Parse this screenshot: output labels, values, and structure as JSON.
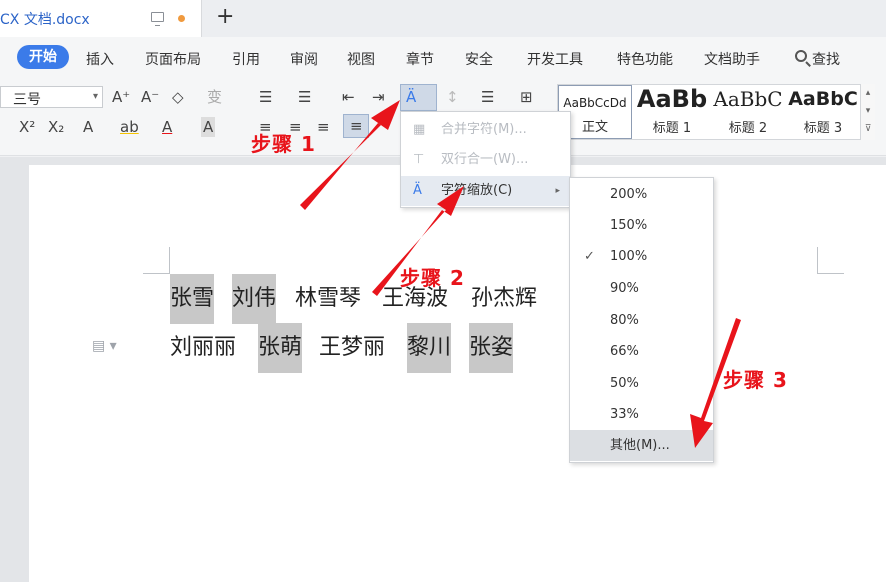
{
  "tab": {
    "title": "CX 文档.docx"
  },
  "menu": [
    "开始",
    "插入",
    "页面布局",
    "引用",
    "审阅",
    "视图",
    "章节",
    "安全",
    "开发工具",
    "特色功能",
    "文档助手"
  ],
  "search_label": "查找",
  "ribbon": {
    "font_size": "三号",
    "row1": [
      "A⁺",
      "A⁻",
      "◇",
      "变",
      "☰",
      "☰",
      "⇤",
      "⇥",
      "Ä",
      "↕"
    ],
    "row2": [
      "X²",
      "X₂",
      "A",
      "ab",
      "A",
      "A"
    ]
  },
  "styles": [
    {
      "sample": "AaBbCcDd",
      "caption": "正文"
    },
    {
      "sample": "AaBb",
      "caption": "标题 1"
    },
    {
      "sample": "AaBbC",
      "caption": "标题 2"
    },
    {
      "sample": "AaBbC",
      "caption": "标题 3"
    }
  ],
  "document": {
    "line1": [
      {
        "text": "张雪",
        "highlight": true
      },
      {
        "text": "刘伟",
        "highlight": true
      },
      {
        "text": "林雪琴",
        "highlight": false
      },
      {
        "text": "王海波",
        "highlight": false
      },
      {
        "text": "孙杰辉",
        "highlight": false
      }
    ],
    "line2": [
      {
        "text": "刘丽丽",
        "highlight": false
      },
      {
        "text": "张萌",
        "highlight": true
      },
      {
        "text": "王梦丽",
        "highlight": false
      },
      {
        "text": "黎川",
        "highlight": true
      },
      {
        "text": "张姿",
        "highlight": true
      }
    ]
  },
  "dropdown": {
    "items": [
      {
        "label": "合并字符(M)...",
        "enabled": false
      },
      {
        "label": "双行合一(W)...",
        "enabled": false
      },
      {
        "label": "字符缩放(C)",
        "enabled": true
      }
    ]
  },
  "scale_menu": {
    "items": [
      "200%",
      "150%",
      "100%",
      "90%",
      "80%",
      "66%",
      "50%",
      "33%",
      "其他(M)..."
    ],
    "checked": "100%"
  },
  "annotations": [
    "步骤 1",
    "步骤 2",
    "步骤 3"
  ],
  "colors": {
    "accent": "#3b7be9",
    "annotation_red": "#e8141b",
    "highlight": "#c8c8c8"
  }
}
